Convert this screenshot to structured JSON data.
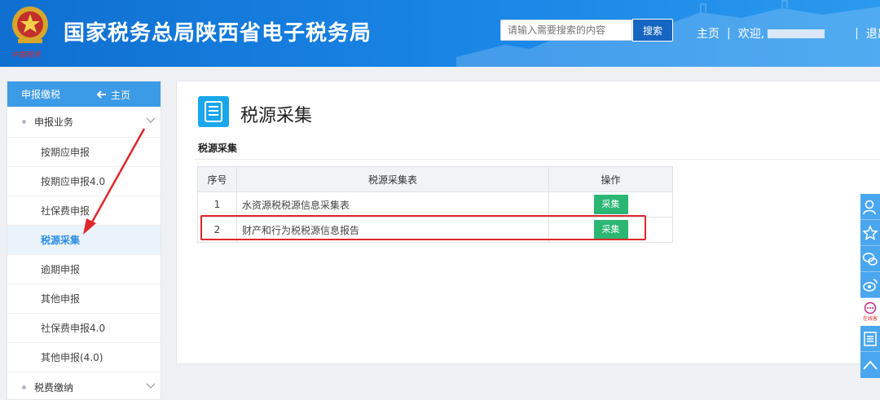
{
  "header": {
    "title": "国家税务总局陕西省电子税务局",
    "emblem_text": "中国税务",
    "search_placeholder": "请输入需要搜索的内容",
    "search_button": "搜索",
    "nav": {
      "home": "主页",
      "welcome": "欢迎,",
      "logout": "退出"
    }
  },
  "sidebar": {
    "head_title": "申报缴税",
    "head_home": "主页",
    "group1": "申报业务",
    "items": [
      "按期应申报",
      "按期应申报4.0",
      "社保费申报",
      "税源采集",
      "逾期申报",
      "其他申报",
      "社保费申报4.0",
      "其他申报(4.0)"
    ],
    "group2": "税费缴纳"
  },
  "main": {
    "title": "税源采集",
    "section": "税源采集",
    "table": {
      "headers": [
        "序号",
        "税源采集表",
        "操作"
      ],
      "rows": [
        {
          "no": "1",
          "name": "水资源税税源信息采集表",
          "action": "采集"
        },
        {
          "no": "2",
          "name": "财产和行为税税源信息报告",
          "action": "采集"
        }
      ]
    }
  },
  "float_bar": {
    "service_label": "在线客"
  },
  "colors": {
    "header_blue": "#1a86e6",
    "sidebar_head": "#3c9be6",
    "active_text": "#2d8de3",
    "button_green": "#2bb673",
    "highlight_red": "#e0262b"
  }
}
